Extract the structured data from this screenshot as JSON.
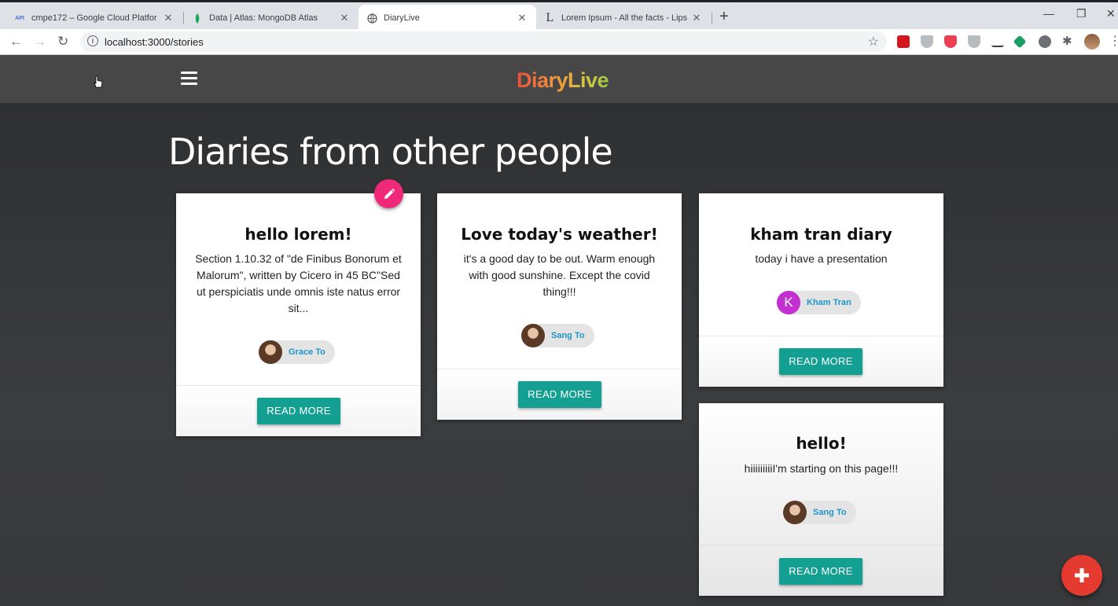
{
  "browser": {
    "tabs": [
      {
        "title": "cmpe172 – Google Cloud Platfor",
        "icon": "api-icon",
        "icon_text": "API"
      },
      {
        "title": "Data | Atlas: MongoDB Atlas",
        "icon": "mongodb-leaf-icon"
      },
      {
        "title": "DiaryLive",
        "icon": "globe-icon",
        "active": true
      },
      {
        "title": "Lorem Ipsum - All the facts - Lips",
        "icon": "lipsum-icon",
        "icon_text": "L"
      }
    ],
    "url": "localhost:3000/stories"
  },
  "app": {
    "brand": "DiaryLive",
    "page_title": "Diaries from other people",
    "read_more_label": "READ MORE",
    "colors": {
      "nav_bg": "#474747",
      "button_teal": "#13a093",
      "edit_fab_pink": "#f0287a",
      "add_fab_red": "#e43a2f",
      "author_link": "#2196c8",
      "letter_avatar": "#c42fd1"
    },
    "stories": [
      {
        "title": "hello lorem!",
        "body": "Section 1.10.32 of \"de Finibus Bonorum et Malorum\", written by Cicero in 45 BC\"Sed ut perspiciatis unde omnis iste natus error sit...",
        "author": "Grace To",
        "avatar": "photo"
      },
      {
        "title": "Love today's weather!",
        "body": "it's a good day to be out. Warm enough with good sunshine. Except the covid thing!!!",
        "author": "Sang To",
        "avatar": "photo"
      },
      {
        "title": "kham tran diary",
        "body": "today i have a presentation",
        "author": "Kham Tran",
        "avatar": "letter",
        "avatar_letter": "K"
      },
      {
        "title": "hello!",
        "body": "hiiiiiiiiiI'm starting on this page!!!",
        "author": "Sang To",
        "avatar": "photo"
      }
    ]
  }
}
